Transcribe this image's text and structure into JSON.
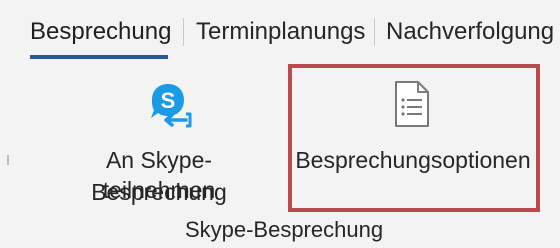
{
  "tabs": [
    {
      "label": "Besprechung",
      "active": true
    },
    {
      "label": "Terminplanungs"
    },
    {
      "label": "Nachverfolgung"
    }
  ],
  "ribbon": {
    "group_label": "Skype-Besprechung",
    "buttons": {
      "skype_join": {
        "line1": "An Skype-Besprechung",
        "line2": "teilnehmen",
        "icon": "skype-join-icon"
      },
      "meeting_options": {
        "label": "Besprechungsoptionen",
        "icon": "meeting-options-document-icon"
      }
    }
  },
  "colors": {
    "active_tab_underline": "#2b579a",
    "highlight_border": "#b94a4e",
    "skype_blue": "#1a9be6"
  }
}
